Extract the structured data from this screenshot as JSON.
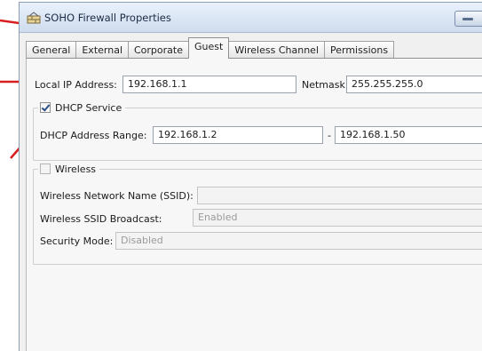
{
  "window": {
    "title": "SOHO Firewall Properties"
  },
  "tabs": [
    {
      "label": "General",
      "active": false
    },
    {
      "label": "External",
      "active": false
    },
    {
      "label": "Corporate",
      "active": false
    },
    {
      "label": "Guest",
      "active": true
    },
    {
      "label": "Wireless Channel",
      "active": false
    },
    {
      "label": "Permissions",
      "active": false
    }
  ],
  "guest": {
    "local_ip_label": "Local IP Address:",
    "local_ip_value": "192.168.1.1",
    "netmask_label": "Netmask:",
    "netmask_value": "255.255.255.0",
    "dhcp": {
      "label": "DHCP Service",
      "checked": true,
      "range_label": "DHCP Address Range:",
      "range_start": "192.168.1.2",
      "range_separator": "-",
      "range_end": "192.168.1.50"
    },
    "wireless": {
      "label": "Wireless",
      "checked": false,
      "ssid_label": "Wireless Network Name (SSID):",
      "ssid_value": "",
      "broadcast_label": "Wireless SSID Broadcast:",
      "broadcast_value": "Enabled",
      "security_label": "Security Mode:",
      "security_value": "Disabled"
    }
  },
  "colors": {
    "callout": "#d81e1e",
    "title_bg": "#dce6f4"
  }
}
